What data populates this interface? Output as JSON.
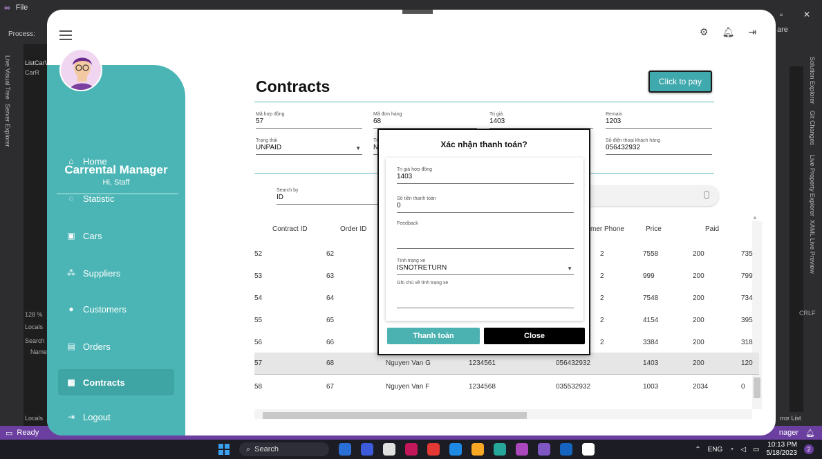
{
  "vs": {
    "menu_file": "File",
    "process_label": "Process:",
    "left_tabs": [
      "Live Visual Tree",
      "Server Explorer"
    ],
    "pane_title": "ListCarV",
    "pane_item": "CarR",
    "zoom": "128 %",
    "locals_label": "Locals",
    "search_label": "Search",
    "name_label": "Name",
    "locals_tab": "Locals",
    "right_tabs": [
      "Solution Explorer",
      "Git Changes",
      "Live Property Explorer",
      "XAML Live Preview"
    ],
    "share": "are",
    "crlf": "CRLF",
    "error_list": "rror List",
    "status_ready": "Ready",
    "status_right": "nager",
    "colors": {
      "status_bar": "#6b3fa0",
      "chrome": "#2d2d30"
    }
  },
  "taskbar": {
    "search_label": "Search",
    "lang": "ENG",
    "time": "10:13 PM",
    "date": "5/18/2023",
    "notif_count": "2"
  },
  "app": {
    "title": "Carrental Manager",
    "greeting": "Hi, Staff",
    "accent_color": "#4bb5b5",
    "nav": [
      {
        "icon": "home-icon",
        "label": "Home"
      },
      {
        "icon": "statistic-icon",
        "label": "Statistic"
      },
      {
        "icon": "car-icon",
        "label": "Cars"
      },
      {
        "icon": "suppliers-icon",
        "label": "Suppliers"
      },
      {
        "icon": "customers-icon",
        "label": "Customers"
      },
      {
        "icon": "orders-icon",
        "label": "Orders"
      },
      {
        "icon": "contracts-icon",
        "label": "Contracts",
        "active": true
      },
      {
        "icon": "logout-icon",
        "label": "Logout"
      }
    ]
  },
  "contracts": {
    "page_title": "Contracts",
    "pay_button": "Click to pay",
    "fields": {
      "contract_id_label": "Mã hợp đồng",
      "contract_id_value": "57",
      "order_id_label": "Mã đơn hàng",
      "order_id_value": "68",
      "value_label": "Trị giá",
      "value_value": "1403",
      "remain_label": "Remain",
      "remain_value": "1203",
      "status_label": "Trạng thái",
      "status_value": "UNPAID",
      "name_label": "Tê",
      "name_value": "N",
      "phone_label": "Số điện thoại khách hàng",
      "phone_value": "056432932"
    },
    "search": {
      "label": "Search by",
      "value": "ID"
    },
    "columns": [
      "Contract ID",
      "Order ID",
      "mer Phone",
      "Price",
      "Paid"
    ],
    "rows": [
      {
        "contract_id": "52",
        "order_id": "62",
        "name": "",
        "cccd": "",
        "phone": "2",
        "price": "7558",
        "paid": "200",
        "remain": "735"
      },
      {
        "contract_id": "53",
        "order_id": "63",
        "name": "",
        "cccd": "",
        "phone": "2",
        "price": "999",
        "paid": "200",
        "remain": "799"
      },
      {
        "contract_id": "54",
        "order_id": "64",
        "name": "",
        "cccd": "",
        "phone": "2",
        "price": "7548",
        "paid": "200",
        "remain": "734"
      },
      {
        "contract_id": "55",
        "order_id": "65",
        "name": "",
        "cccd": "",
        "phone": "2",
        "price": "4154",
        "paid": "200",
        "remain": "395"
      },
      {
        "contract_id": "56",
        "order_id": "66",
        "name": "",
        "cccd": "",
        "phone": "2",
        "price": "3384",
        "paid": "200",
        "remain": "318"
      },
      {
        "contract_id": "57",
        "order_id": "68",
        "name": "Nguyen Van G",
        "cccd": "1234561",
        "phone": "056432932",
        "price": "1403",
        "paid": "200",
        "remain": "120",
        "selected": true
      },
      {
        "contract_id": "58",
        "order_id": "67",
        "name": "Nguyen Van F",
        "cccd": "1234568",
        "phone": "035532932",
        "price": "1003",
        "paid": "2034",
        "remain": "0"
      }
    ]
  },
  "modal": {
    "title": "Xác nhận thanh toán?",
    "contract_value_label": "Trị giá hợp đồng",
    "contract_value": "1403",
    "payment_label": "Số tiền thanh toán",
    "payment_value": "0",
    "feedback_label": "Feedback",
    "feedback_value": "",
    "car_status_label": "Tình trạng xe",
    "car_status_value": "ISNOTRETURN",
    "car_note_label": "Ghi chú về tình trạng xe",
    "car_note_value": "",
    "pay_button": "Thanh toán",
    "close_button": "Close"
  }
}
